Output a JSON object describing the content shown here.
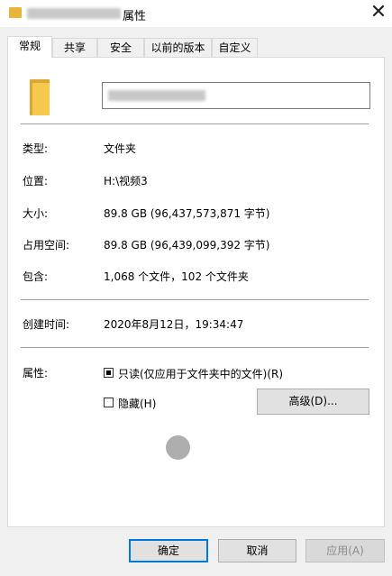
{
  "window": {
    "title_suffix": "属性",
    "close_glyph": "✕"
  },
  "tabs": [
    {
      "label": "常规"
    },
    {
      "label": "共享"
    },
    {
      "label": "安全"
    },
    {
      "label": "以前的版本"
    },
    {
      "label": "自定义"
    }
  ],
  "general": {
    "type_label": "类型:",
    "type_value": "文件夹",
    "location_label": "位置:",
    "location_value": "H:\\视频3",
    "size_label": "大小:",
    "size_value": "89.8 GB (96,437,573,871 字节)",
    "size_on_disk_label": "占用空间:",
    "size_on_disk_value": "89.8 GB (96,439,099,392 字节)",
    "contains_label": "包含:",
    "contains_value": "1,068 个文件，102 个文件夹",
    "created_label": "创建时间:",
    "created_value": "2020年8月12日，19:34:47",
    "attributes_label": "属性:",
    "readonly_label": "只读(仅应用于文件夹中的文件)(R)",
    "hidden_label": "隐藏(H)",
    "advanced_button": "高级(D)..."
  },
  "footer": {
    "ok_label": "确定",
    "cancel_label": "取消",
    "apply_label": "应用(A)"
  },
  "icons": {
    "folder": "folder-icon",
    "close": "close-icon",
    "cursor": "cursor-indicator"
  },
  "colors": {
    "accent": "#0078d7",
    "folder": "#f5c94b"
  }
}
